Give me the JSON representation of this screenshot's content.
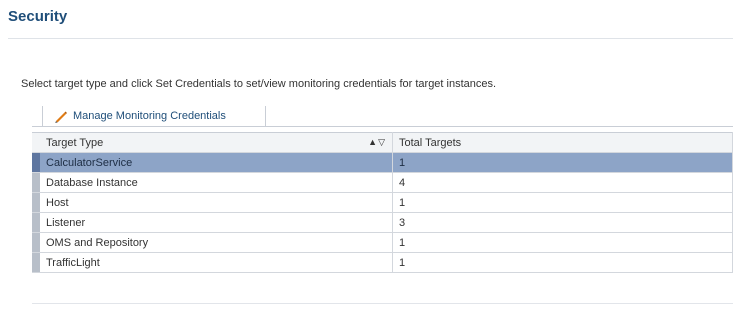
{
  "page": {
    "title": "Security",
    "instructions": "Select target type and click Set Credentials to set/view monitoring credentials for target instances."
  },
  "toolbar": {
    "manage_label": "Manage Monitoring Credentials",
    "manage_icon": "pencil-icon"
  },
  "table": {
    "columns": [
      "Target Type",
      "Total Targets"
    ],
    "sort_icons": "sort-ascending-descending-icon",
    "rows": [
      {
        "type": "CalculatorService",
        "total": "1",
        "selected": true
      },
      {
        "type": "Database Instance",
        "total": "4",
        "selected": false
      },
      {
        "type": "Host",
        "total": "1",
        "selected": false
      },
      {
        "type": "Listener",
        "total": "3",
        "selected": false
      },
      {
        "type": "OMS and Repository",
        "total": "1",
        "selected": false
      },
      {
        "type": "TrafficLight",
        "total": "1",
        "selected": false
      }
    ]
  },
  "colors": {
    "title": "#1f4e79",
    "selected_row": "#8da4c7",
    "pencil": "#e07b14"
  }
}
